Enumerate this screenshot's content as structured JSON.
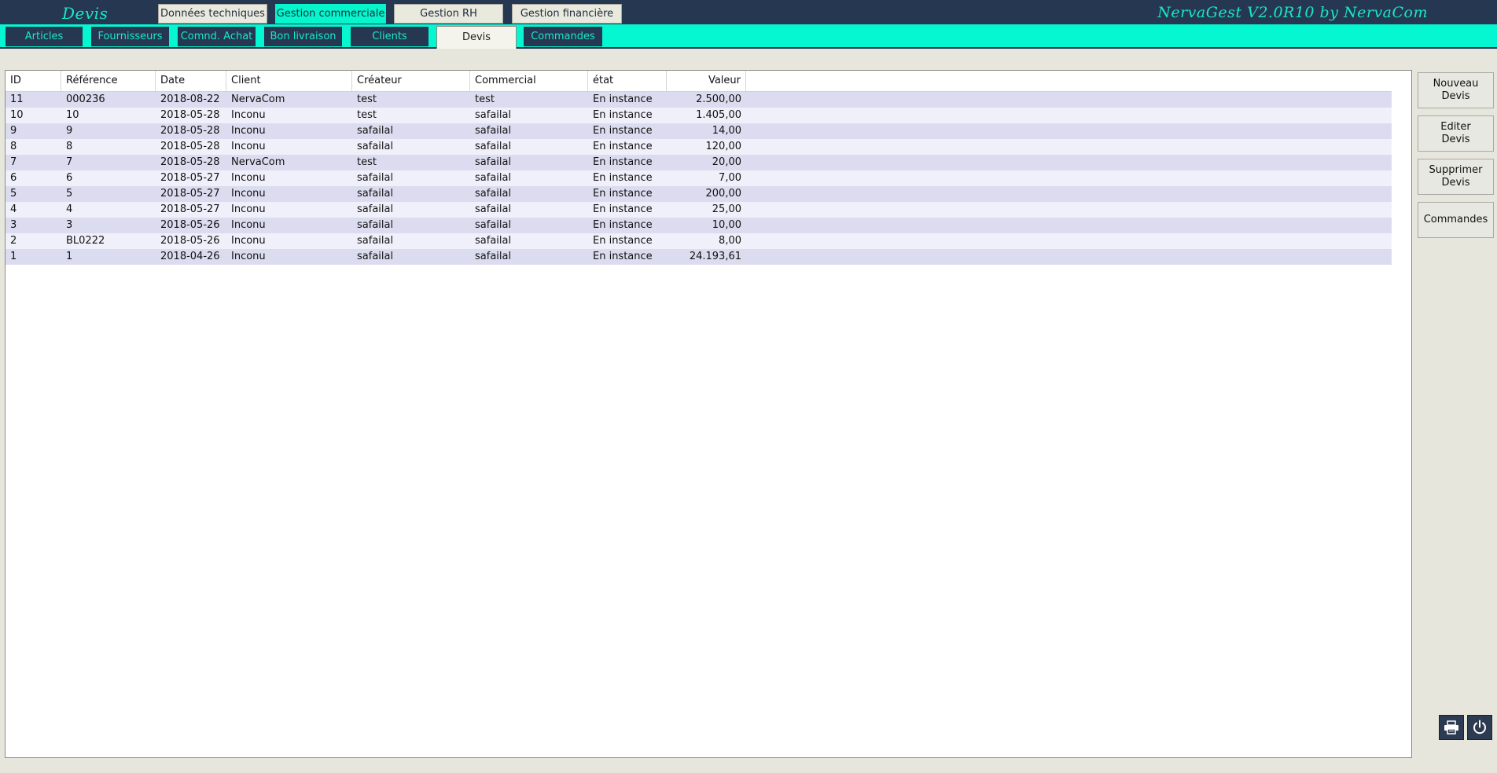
{
  "header": {
    "page_title": "Devis",
    "brand": "NervaGest V2.0R10 by NervaCom",
    "main_tabs": [
      {
        "label": "Données techniques",
        "active": false
      },
      {
        "label": "Gestion commerciale",
        "active": true
      },
      {
        "label": "Gestion RH",
        "active": false
      },
      {
        "label": "Gestion financière",
        "active": false
      }
    ]
  },
  "subnav": {
    "tabs": [
      {
        "label": "Articles",
        "active": false
      },
      {
        "label": "Fournisseurs",
        "active": false
      },
      {
        "label": "Comnd. Achat",
        "active": false
      },
      {
        "label": "Bon livraison",
        "active": false
      },
      {
        "label": "Clients",
        "active": false
      },
      {
        "label": "Devis",
        "active": true
      },
      {
        "label": "Commandes",
        "active": false
      }
    ]
  },
  "table": {
    "columns": [
      "ID",
      "Référence",
      "Date",
      "Client",
      "Créateur",
      "Commercial",
      "état",
      "Valeur"
    ],
    "rows": [
      [
        "11",
        "000236",
        "2018-08-22",
        "NervaCom",
        "test",
        "test",
        "En instance",
        "2.500,00"
      ],
      [
        "10",
        "10",
        "2018-05-28",
        "Inconu",
        "test",
        "safailal",
        "En instance",
        "1.405,00"
      ],
      [
        "9",
        "9",
        "2018-05-28",
        "Inconu",
        "safailal",
        "safailal",
        "En instance",
        "14,00"
      ],
      [
        "8",
        "8",
        "2018-05-28",
        "Inconu",
        "safailal",
        "safailal",
        "En instance",
        "120,00"
      ],
      [
        "7",
        "7",
        "2018-05-28",
        "NervaCom",
        "test",
        "safailal",
        "En instance",
        "20,00"
      ],
      [
        "6",
        "6",
        "2018-05-27",
        "Inconu",
        "safailal",
        "safailal",
        "En instance",
        "7,00"
      ],
      [
        "5",
        "5",
        "2018-05-27",
        "Inconu",
        "safailal",
        "safailal",
        "En instance",
        "200,00"
      ],
      [
        "4",
        "4",
        "2018-05-27",
        "Inconu",
        "safailal",
        "safailal",
        "En instance",
        "25,00"
      ],
      [
        "3",
        "3",
        "2018-05-26",
        "Inconu",
        "safailal",
        "safailal",
        "En instance",
        "10,00"
      ],
      [
        "2",
        "BL0222",
        "2018-05-26",
        "Inconu",
        "safailal",
        "safailal",
        "En instance",
        "8,00"
      ],
      [
        "1",
        "1",
        "2018-04-26",
        "Inconu",
        "safailal",
        "safailal",
        "En instance",
        "24.193,61"
      ]
    ]
  },
  "actions": {
    "new_quote": "Nouveau\nDevis",
    "edit_quote": "Editer\nDevis",
    "delete_quote": "Supprimer\nDevis",
    "orders": "Commandes"
  },
  "icons": {
    "print": "printer-icon",
    "power": "power-icon"
  },
  "colors": {
    "navy": "#263752",
    "accent": "#07f5cc",
    "row_odd": "#dcdcf0",
    "row_even": "#f0f0fa"
  }
}
